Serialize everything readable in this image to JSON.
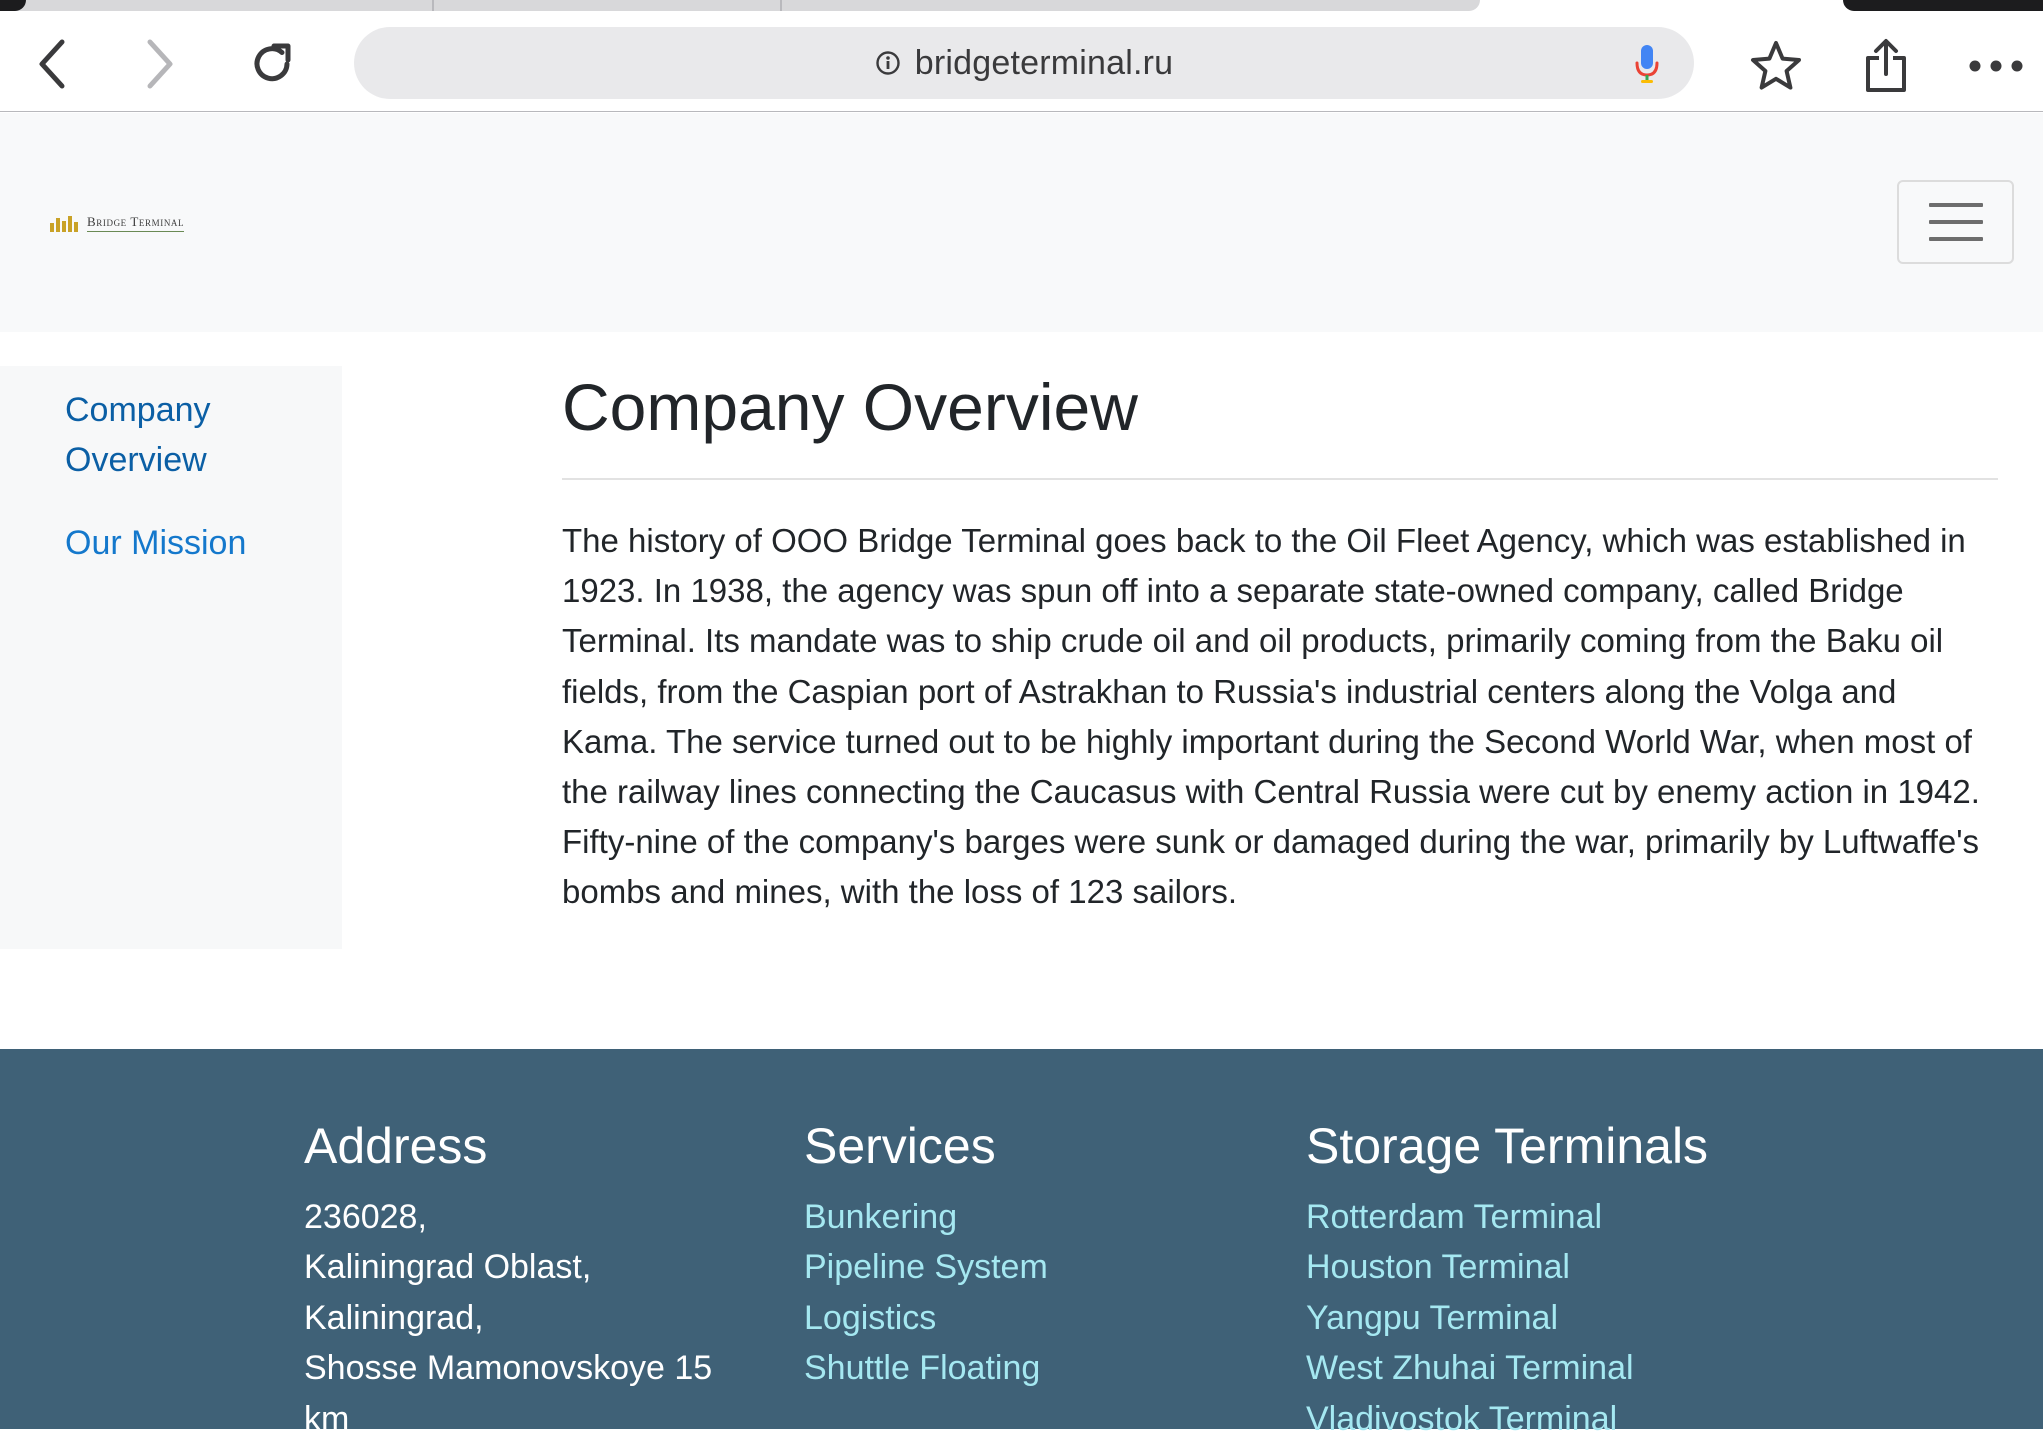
{
  "browser": {
    "url": "bridgeterminal.ru"
  },
  "site": {
    "logo_text": "Bridge Terminal"
  },
  "sidebar": {
    "items": [
      {
        "label": "Company Overview"
      },
      {
        "label": "Our Mission"
      }
    ]
  },
  "main": {
    "title": "Company Overview",
    "body": "The history of OOO Bridge Terminal goes back to the Oil Fleet Agency, which was established in 1923. In 1938, the agency was spun off into a separate state-owned company, called Bridge Terminal. Its mandate was to ship crude oil and oil products, primarily coming from the Baku oil fields, from the Caspian port of Astrakhan to Russia's industrial centers along the Volga and Kama. The service turned out to be highly important during the Second World War, when most of the railway lines connecting the Caucasus with Central Russia were cut by enemy action in 1942. Fifty-nine of the company's barges were sunk or damaged during the war, primarily by Luftwaffe's bombs and mines, with the loss of 123 sailors."
  },
  "footer": {
    "address": {
      "title": "Address",
      "lines": [
        "236028,",
        "Kaliningrad Oblast,",
        "Kaliningrad,",
        "Shosse Mamonovskoye 15",
        "km"
      ]
    },
    "services": {
      "title": "Services",
      "links": [
        "Bunkering",
        "Pipeline System",
        "Logistics",
        "Shuttle Floating"
      ]
    },
    "terminals": {
      "title": "Storage Terminals",
      "links": [
        "Rotterdam Terminal",
        "Houston Terminal",
        "Yangpu Terminal",
        "West Zhuhai Terminal",
        "Vladivostok Terminal"
      ]
    }
  },
  "colors": {
    "footer_bg": "#3f6177",
    "footer_link": "#a5e8f1",
    "sidebar_link": "#0b5fa5",
    "navbar_bg": "#f8f9fa"
  },
  "icons": {
    "back": "chevron-left-icon",
    "forward": "chevron-right-icon",
    "reload": "reload-icon",
    "info": "info-icon",
    "mic": "microphone-icon",
    "bookmark": "star-icon",
    "share": "share-icon",
    "more": "more-icon",
    "menu": "hamburger-icon"
  }
}
